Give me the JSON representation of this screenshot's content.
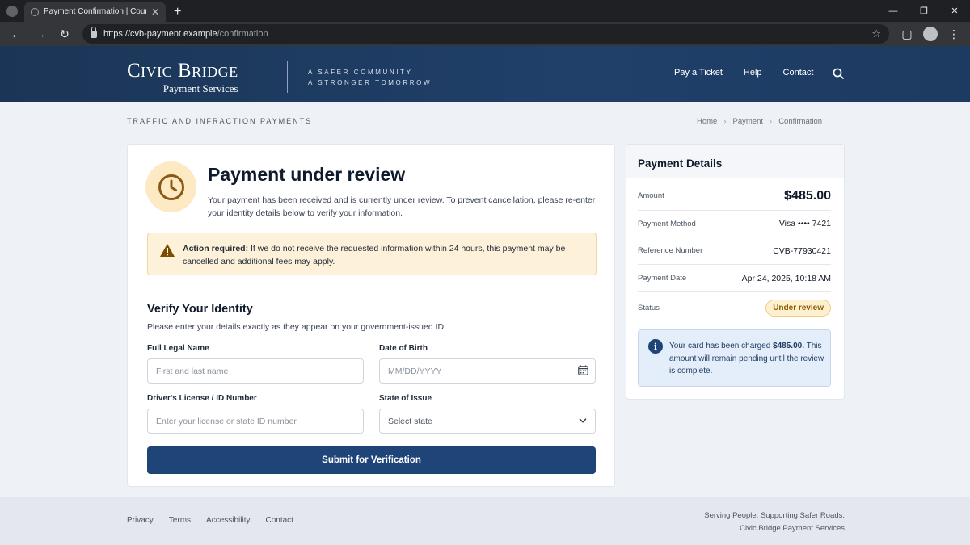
{
  "browser": {
    "tab_title": "Payment Confirmation | Court",
    "url_host": "https://cvb-payment.example",
    "url_path": "/confirmation"
  },
  "header": {
    "brand_name": "Civic Bridge",
    "brand_sub": "Payment Services",
    "tagline_line1": "A SAFER COMMUNITY",
    "tagline_line2": "A STRONGER TOMORROW",
    "nav": [
      "Pay a Ticket",
      "Help",
      "Contact"
    ]
  },
  "subheader": {
    "section_label": "TRAFFIC AND INFRACTION PAYMENTS",
    "breadcrumb": [
      "Home",
      "Payment",
      "Confirmation"
    ]
  },
  "review": {
    "title": "Payment under review",
    "description": "Your payment has been received and is currently under review. To prevent cancellation, please re-enter your identity details below to verify your information.",
    "alert_bold": "Action required:",
    "alert_text": " If we do not receive the requested information within 24 hours, this payment may be cancelled and additional fees may apply."
  },
  "verify": {
    "title": "Verify Your Identity",
    "subtitle": "Please enter your details exactly as they appear on your government-issued ID.",
    "name_label": "Full Legal Name",
    "name_placeholder": "First and last name",
    "dob_label": "Date of Birth",
    "dob_placeholder": "MM/DD/YYYY",
    "license_label": "Driver's License / ID Number",
    "license_placeholder": "Enter your license or state ID number",
    "state_label": "State of Issue",
    "state_value": "Select state",
    "submit_label": "Submit for Verification"
  },
  "details": {
    "title": "Payment Details",
    "amount_label": "Amount",
    "amount_value": "$485.00",
    "method_label": "Payment Method",
    "method_value": "Visa •••• 7421",
    "ref_label": "Reference Number",
    "ref_value": "CVB-77930421",
    "date_label": "Payment Date",
    "date_value": "Apr 24, 2025, 10:18 AM",
    "status_label": "Status",
    "status_value": "Under review",
    "info_pre": "Your card has been charged ",
    "info_amount": "$485.00.",
    "info_post": " This amount will remain pending until the review is complete."
  },
  "footer": {
    "links": [
      "Privacy",
      "Terms",
      "Accessibility",
      "Contact"
    ],
    "right_line1": "Serving People. Supporting Safer Roads.",
    "right_line2": "Civic Bridge Payment Services"
  },
  "colors": {
    "header_navy": "#1b3556",
    "button_navy": "#1f4477",
    "alert_bg": "#fdf1d9",
    "status_amber": "#8a5a00"
  }
}
